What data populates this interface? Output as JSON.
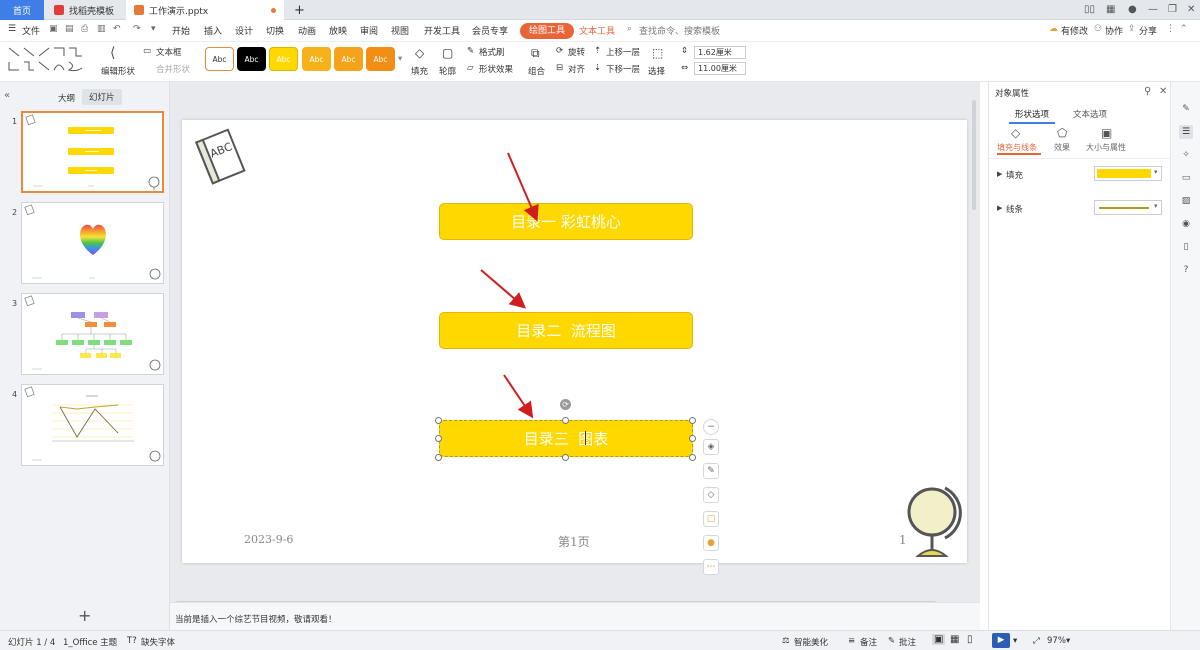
{
  "tabs": {
    "home": "首页",
    "template": "找稻壳模板",
    "doc": "工作演示.pptx",
    "add": "+"
  },
  "window": {
    "actions": [
      "有修改",
      "协作",
      "分享"
    ]
  },
  "menu": {
    "file": "文件",
    "items": [
      "开始",
      "插入",
      "设计",
      "切换",
      "动画",
      "放映",
      "审阅",
      "视图",
      "开发工具",
      "会员专享"
    ],
    "drawing_tools": "绘图工具",
    "text_tools": "文本工具",
    "search_placeholder": "查找命令、搜索模板"
  },
  "ribbon": {
    "edit_shape": "编辑形状",
    "textbox": "文本框",
    "merge_shape": "合并形状",
    "style_samples": [
      "Abc",
      "Abc",
      "Abc",
      "Abc",
      "Abc",
      "Abc"
    ],
    "fill": "填充",
    "outline": "轮廓",
    "format_brush": "格式刷",
    "shape_effect": "形状效果",
    "group": "组合",
    "rotate": "旋转",
    "align": "对齐",
    "move_up": "上移一层",
    "move_down": "下移一层",
    "select": "选择",
    "height": "1.62厘米",
    "width": "11.00厘米"
  },
  "colors": {
    "accent": "#e8653a",
    "yellow": "#ffd800",
    "brand_blue": "#3f7ee8"
  },
  "leftpane": {
    "outline_tab": "大纲",
    "slides_tab": "幻灯片",
    "add_slide": "+",
    "slide_numbers": [
      "1",
      "2",
      "3",
      "4"
    ]
  },
  "slide": {
    "badge": "ABC",
    "items": [
      "目录一 彩虹桃心",
      "目录二  流程图",
      "目录三  图表"
    ],
    "date": "2023-9-6",
    "page": "第1页",
    "num": "1"
  },
  "notes": {
    "text": "当前是插入一个综艺节目视频，敬请观看！"
  },
  "rpanel": {
    "title": "对象属性",
    "tabs": [
      "形状选项",
      "文本选项"
    ],
    "subtabs": [
      "填充与线条",
      "效果",
      "大小与属性"
    ],
    "fill_label": "填充",
    "line_label": "线条"
  },
  "status": {
    "slide_info": "幻灯片 1 / 4",
    "theme": "1_Office 主题",
    "missing_font": "缺失字体",
    "beautify": "智能美化",
    "notes": "备注",
    "comment": "批注",
    "zoom": "97%"
  }
}
